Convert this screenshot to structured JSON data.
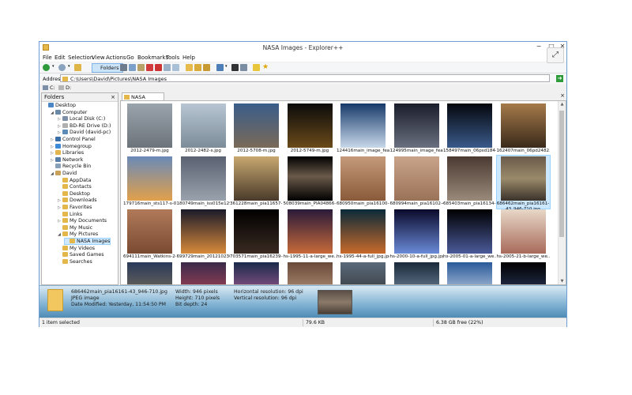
{
  "window": {
    "title": "NASA Images - Explorer++",
    "min": "−",
    "max": "□",
    "close": "✕"
  },
  "menu": [
    {
      "label": "File"
    },
    {
      "label": "Edit"
    },
    {
      "label": "Selection"
    },
    {
      "label": "View"
    },
    {
      "label": "Actions"
    },
    {
      "label": "Go"
    },
    {
      "label": "Bookmarks"
    },
    {
      "label": "Tools"
    },
    {
      "label": "Help"
    }
  ],
  "toolbar": {
    "folders_label": "Folders"
  },
  "address": {
    "label": "Address",
    "value": "C:\\Users\\David\\Pictures\\NASA Images"
  },
  "drives": [
    {
      "label": "C:"
    },
    {
      "label": "D:"
    }
  ],
  "folders_pane": {
    "title": "Folders",
    "close": "×",
    "items": [
      {
        "label": "Desktop"
      },
      {
        "label": "Computer"
      },
      {
        "label": "Local Disk (C:)"
      },
      {
        "label": "BD-RE Drive (D:)"
      },
      {
        "label": "David (david-pc)"
      },
      {
        "label": "Control Panel"
      },
      {
        "label": "Homegroup"
      },
      {
        "label": "Libraries"
      },
      {
        "label": "Network"
      },
      {
        "label": "Recycle Bin"
      },
      {
        "label": "David"
      },
      {
        "label": "AppData"
      },
      {
        "label": "Contacts"
      },
      {
        "label": "Desktop"
      },
      {
        "label": "Downloads"
      },
      {
        "label": "Favorites"
      },
      {
        "label": "Links"
      },
      {
        "label": "My Documents"
      },
      {
        "label": "My Music"
      },
      {
        "label": "My Pictures"
      },
      {
        "label": "NASA Images"
      },
      {
        "label": "My Videos"
      },
      {
        "label": "Saved Games"
      },
      {
        "label": "Searches"
      }
    ]
  },
  "tab": {
    "label": "NASA Images",
    "close": "×"
  },
  "files": [
    {
      "name": "2012-2479-m.jpg"
    },
    {
      "name": "2012-2482-s.jpg"
    },
    {
      "name": "2012-5708-m.jpg"
    },
    {
      "name": "2012-5749-m.jpg"
    },
    {
      "name": "124416main_image_fea..."
    },
    {
      "name": "124995main_image_fea..."
    },
    {
      "name": "158497main_06psd184-..."
    },
    {
      "name": "162407main_06pd2482..."
    },
    {
      "name": "179716main_sts117-s-0..."
    },
    {
      "name": "180749main_iss015e129..."
    },
    {
      "name": "361228main_pia11657-..."
    },
    {
      "name": "508039main_PIA04866-..."
    },
    {
      "name": "680950main_pia16100-4..."
    },
    {
      "name": "680994main_pia16102-4..."
    },
    {
      "name": "685403main_pia16134-..."
    },
    {
      "name": "686462main_pia16161-43_946-710.jpg"
    },
    {
      "name": "694111main_Watkins-2-..."
    },
    {
      "name": "699729main_201210230..."
    },
    {
      "name": "703571main_pia16239-4..."
    },
    {
      "name": "hs-1995-11-a-large_we..."
    },
    {
      "name": "hs-1995-44-a-full_jpg.jpg"
    },
    {
      "name": "hs-2000-10-a-full_jpg.jpg"
    },
    {
      "name": "hs-2005-01-a-large_we..."
    },
    {
      "name": "hs-2005-21-b-large_we..."
    },
    {
      "name": ""
    },
    {
      "name": ""
    },
    {
      "name": ""
    },
    {
      "name": ""
    },
    {
      "name": ""
    },
    {
      "name": ""
    },
    {
      "name": ""
    },
    {
      "name": ""
    }
  ],
  "info": {
    "filename": "686462main_pia16161-43_946-710.jpg",
    "type": "JPEG image",
    "modified": "Date Modified: Yesterday, 11:54:50 PM",
    "width": "Width: 946 pixels",
    "height": "Height: 710 pixels",
    "bitdepth": "Bit depth: 24",
    "hres": "Horizontal resolution: 96 dpi",
    "vres": "Vertical resolution: 96 dpi"
  },
  "status": {
    "selected": "1 item selected",
    "size": "79.6 KB",
    "free": "6.38 GB free (22%)"
  },
  "overlay": {
    "expand_icon": "⤢"
  }
}
